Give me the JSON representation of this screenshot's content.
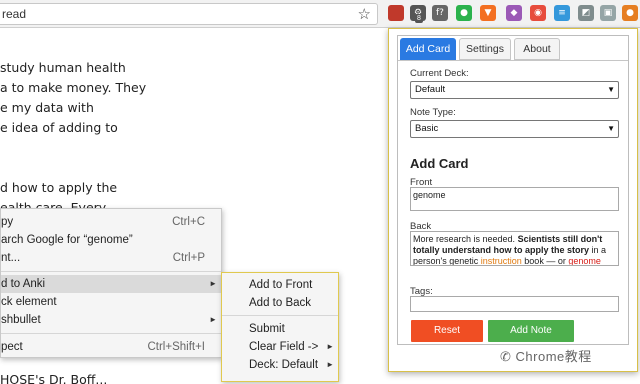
{
  "browser": {
    "url_text": "read",
    "star_icon": "star-icon",
    "extensions": [
      {
        "name": "ublock-icon",
        "glyph": "",
        "color": "#c0392b"
      },
      {
        "name": "settings-gear-icon",
        "glyph": "⚙",
        "color": "#555555"
      },
      {
        "name": "fx-icon",
        "glyph": "f?",
        "color": "#666666"
      },
      {
        "name": "feedly-icon",
        "glyph": "●",
        "color": "#2bb24c"
      },
      {
        "name": "brave-shield-icon",
        "glyph": "▼",
        "color": "#f36f21"
      },
      {
        "name": "shield-icon",
        "glyph": "◆",
        "color": "#9b59b6"
      },
      {
        "name": "color-wheel-icon",
        "glyph": "◉",
        "color": "#e74c3c"
      },
      {
        "name": "rainbow-bars-icon",
        "glyph": "≡",
        "color": "#3498db"
      },
      {
        "name": "puzzle-icon",
        "glyph": "◩",
        "color": "#7f8c8d"
      },
      {
        "name": "image-icon",
        "glyph": "▣",
        "color": "#95a5a6"
      },
      {
        "name": "anki-icon",
        "glyph": "●",
        "color": "#e67e22"
      }
    ],
    "badge": "8"
  },
  "article": {
    "lines": [
      "study human health",
      "a to make money. They",
      "e my data with",
      "e idea of adding to",
      "",
      "",
      "d how to apply the",
      "ealth care. Every"
    ],
    "bottom_line": "HOSE's Dr. Boff..."
  },
  "context_menu": {
    "items": [
      {
        "label": "py",
        "shortcut": "Ctrl+C"
      },
      {
        "label": "arch Google for “genome”",
        "shortcut": ""
      },
      {
        "label": "nt...",
        "shortcut": "Ctrl+P"
      },
      {
        "label": "d to Anki",
        "shortcut": "",
        "arrow": "►"
      },
      {
        "label": "ck element",
        "shortcut": ""
      },
      {
        "label": "shbullet",
        "shortcut": "",
        "arrow": "►"
      },
      {
        "label": "pect",
        "shortcut": "Ctrl+Shift+I"
      }
    ]
  },
  "submenu": {
    "items": [
      {
        "label": "Add to Front"
      },
      {
        "label": "Add to Back"
      },
      {
        "label": "Submit"
      },
      {
        "label": "Clear Field ->",
        "arrow": "►"
      },
      {
        "label": "Deck: Default",
        "arrow": "►"
      }
    ]
  },
  "popup": {
    "tabs": [
      "Add Card",
      "Settings",
      "About"
    ],
    "current_deck_label": "Current Deck:",
    "current_deck_value": "Default",
    "note_type_label": "Note Type:",
    "note_type_value": "Basic",
    "heading": "Add Card",
    "front_label": "Front",
    "front_value": "genome",
    "back_label": "Back",
    "back_parts": {
      "p1": "More research is needed. ",
      "p2": "Scientists still don't totally understand how to apply the story",
      "p3": " in a person's genetic ",
      "p4": "instruction",
      "p5": " book — or ",
      "p6": "genome"
    },
    "tags_label": "Tags:",
    "tags_value": "",
    "reset_label": "Reset",
    "add_note_label": "Add Note",
    "reset_color": "#f04e23",
    "add_note_color": "#4cae4c",
    "active_tab_color": "#2a7ae2"
  },
  "watermark": "Chrome教程"
}
